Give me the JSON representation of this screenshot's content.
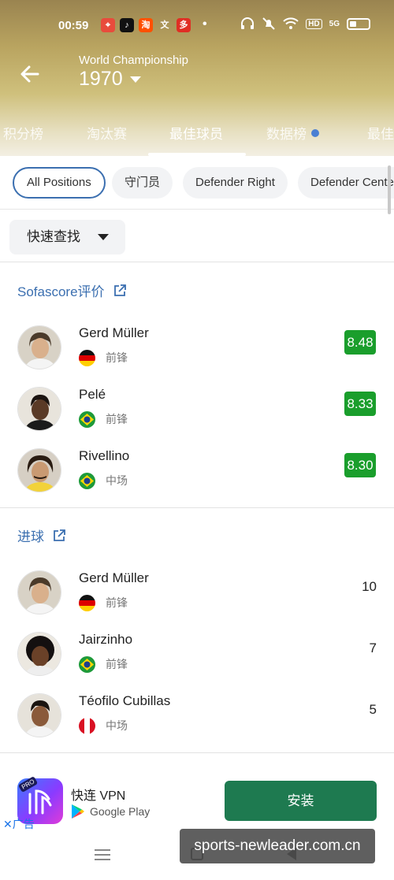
{
  "status_bar": {
    "time": "00:59",
    "apps": [
      {
        "icon": "maps-icon",
        "glyph": "⌖",
        "color": "#e84b3c"
      },
      {
        "icon": "tiktok-icon",
        "glyph": "♪",
        "color": "#111111"
      },
      {
        "icon": "taobao-icon",
        "glyph": "淘",
        "color": "#ff5000"
      },
      {
        "icon": "text-app-icon",
        "glyph": "文",
        "color": "transparent"
      },
      {
        "icon": "pinduoduo-icon",
        "glyph": "多",
        "color": "#e02e24"
      }
    ],
    "hd_label": "HD",
    "signal_label": "5G"
  },
  "header": {
    "subtitle": "World Championship",
    "year": "1970"
  },
  "tabs": [
    {
      "label": "积分榜",
      "active": false
    },
    {
      "label": "淘汰赛",
      "active": false
    },
    {
      "label": "最佳球员",
      "active": true
    },
    {
      "label": "数据榜",
      "active": false,
      "badge": true
    },
    {
      "label": "最佳",
      "active": false
    }
  ],
  "position_filters": [
    "All Positions",
    "守门员",
    "Defender Right",
    "Defender Center"
  ],
  "quick_search": {
    "label": "快速查找"
  },
  "sections": [
    {
      "title": "Sofascore评价",
      "kind": "rating",
      "players": [
        {
          "name": "Gerd Müller",
          "country": "germany",
          "position": "前锋",
          "value": "8.48"
        },
        {
          "name": "Pelé",
          "country": "brazil",
          "position": "前锋",
          "value": "8.33"
        },
        {
          "name": "Rivellino",
          "country": "brazil",
          "position": "中场",
          "value": "8.30"
        }
      ]
    },
    {
      "title": "进球",
      "kind": "goals",
      "players": [
        {
          "name": "Gerd Müller",
          "country": "germany",
          "position": "前锋",
          "value": "10"
        },
        {
          "name": "Jairzinho",
          "country": "brazil",
          "position": "前锋",
          "value": "7"
        },
        {
          "name": "Téofilo Cubillas",
          "country": "peru",
          "position": "中场",
          "value": "5"
        }
      ]
    }
  ],
  "ad": {
    "app_name": "快连 VPN",
    "store": "Google Play",
    "install_label": "安装",
    "ad_label": "广告",
    "pro_label": "PRO"
  },
  "watermark": "sports-newleader.com.cn",
  "colors": {
    "accent_blue": "#3b6fb0",
    "rating_green": "#1a9e2c",
    "install_green": "#1e7a50"
  }
}
